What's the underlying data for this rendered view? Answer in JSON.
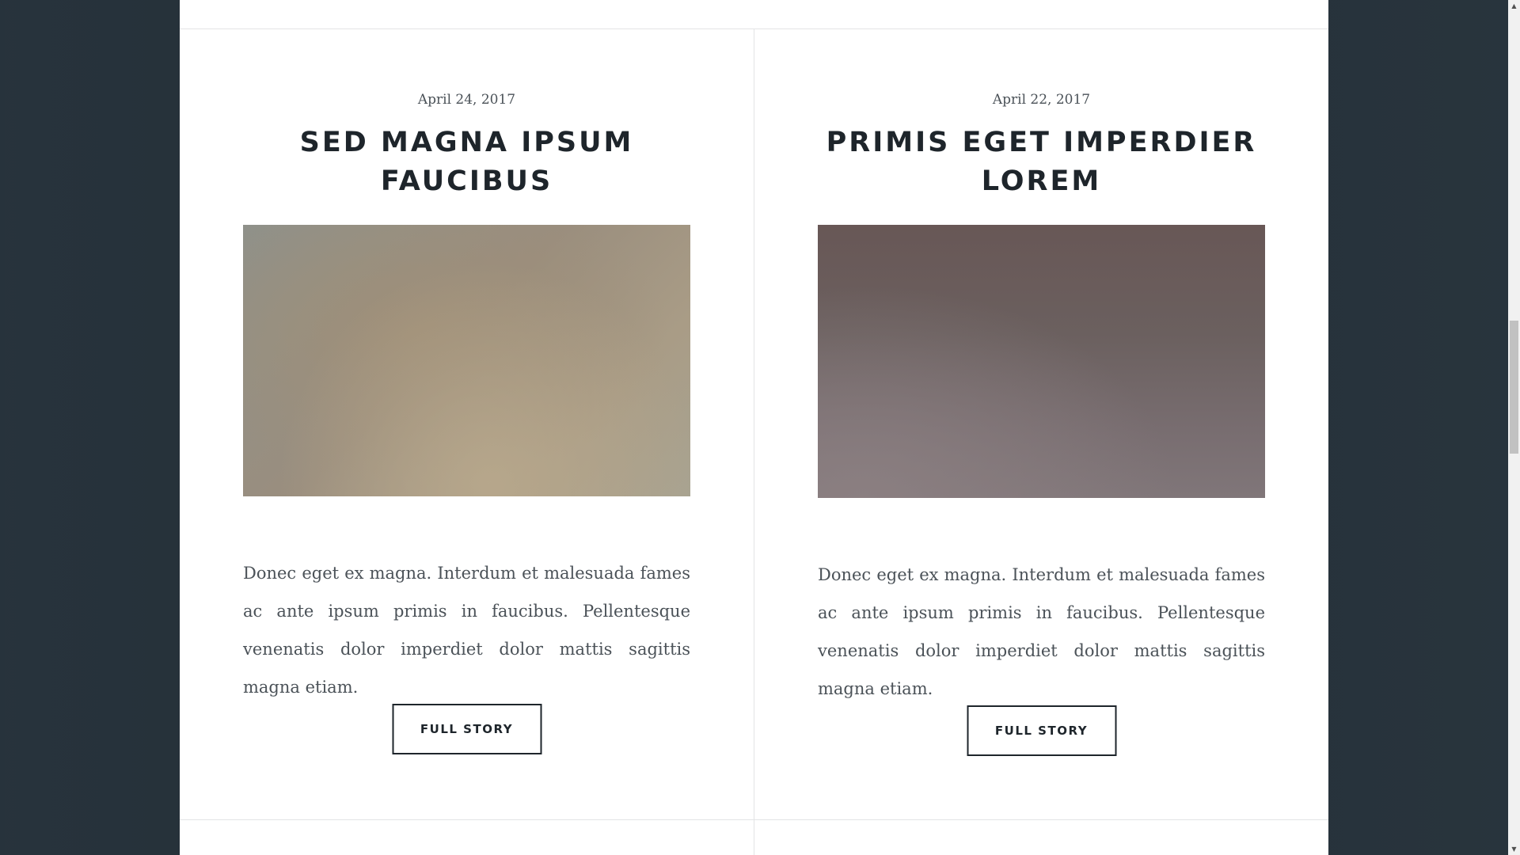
{
  "posts": [
    {
      "date": "April 24, 2017",
      "title": "SED MAGNA IPSUM FAUCIBUS",
      "image_alt": "blurred beige photo",
      "body": "Donec eget ex magna. Interdum et malesuada fames ac ante ipsum primis in faucibus. Pellentesque venenatis dolor imperdiet dolor mattis sagittis magna etiam.",
      "button_label": "FULL STORY"
    },
    {
      "date": "April 22, 2017",
      "title": "PRIMIS EGET IMPERDIER LOREM",
      "image_alt": "blurred mauve photo",
      "body": "Donec eget ex magna. Interdum et malesuada fames ac ante ipsum primis in faucibus. Pellentesque venenatis dolor imperdiet dolor mattis sagittis magna etiam.",
      "button_label": "FULL STORY"
    }
  ],
  "scrollbar": {
    "up_icon": "triangle-up",
    "down_icon": "triangle-down"
  },
  "colors": {
    "background": "#243039",
    "panel": "#ffffff",
    "heading": "#1e252b",
    "text": "#4b5258",
    "rule": "#e3e4e5"
  }
}
